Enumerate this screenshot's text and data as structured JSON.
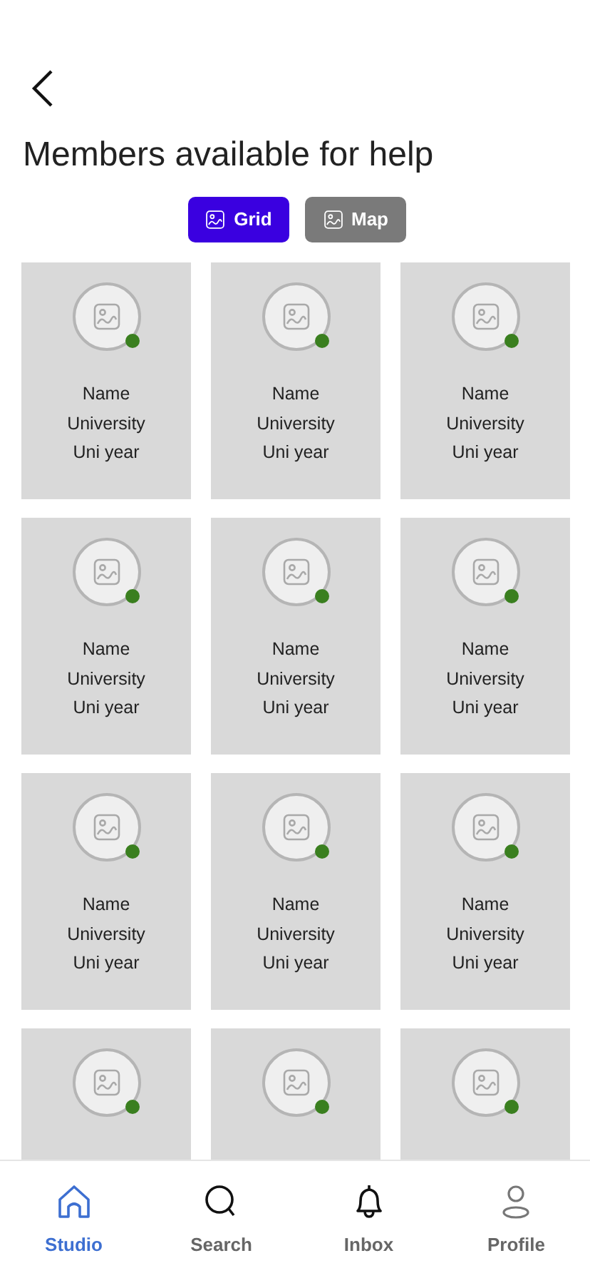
{
  "title": "Members available for help",
  "view_toggle": [
    {
      "label": "Grid",
      "selected": true
    },
    {
      "label": "Map",
      "selected": false
    }
  ],
  "members": [
    {
      "name": "Name",
      "university": "University",
      "year": "Uni year",
      "online": true
    },
    {
      "name": "Name",
      "university": "University",
      "year": "Uni year",
      "online": true
    },
    {
      "name": "Name",
      "university": "University",
      "year": "Uni year",
      "online": true
    },
    {
      "name": "Name",
      "university": "University",
      "year": "Uni year",
      "online": true
    },
    {
      "name": "Name",
      "university": "University",
      "year": "Uni year",
      "online": true
    },
    {
      "name": "Name",
      "university": "University",
      "year": "Uni year",
      "online": true
    },
    {
      "name": "Name",
      "university": "University",
      "year": "Uni year",
      "online": true
    },
    {
      "name": "Name",
      "university": "University",
      "year": "Uni year",
      "online": true
    },
    {
      "name": "Name",
      "university": "University",
      "year": "Uni year",
      "online": true
    },
    {
      "online": true
    },
    {
      "online": true
    },
    {
      "online": true
    }
  ],
  "bottom_nav": [
    {
      "label": "Studio",
      "kind": "home",
      "selected": true
    },
    {
      "label": "Search",
      "kind": "search",
      "selected": false
    },
    {
      "label": "Inbox",
      "kind": "bell",
      "selected": false
    },
    {
      "label": "Profile",
      "kind": "person",
      "selected": false
    }
  ]
}
